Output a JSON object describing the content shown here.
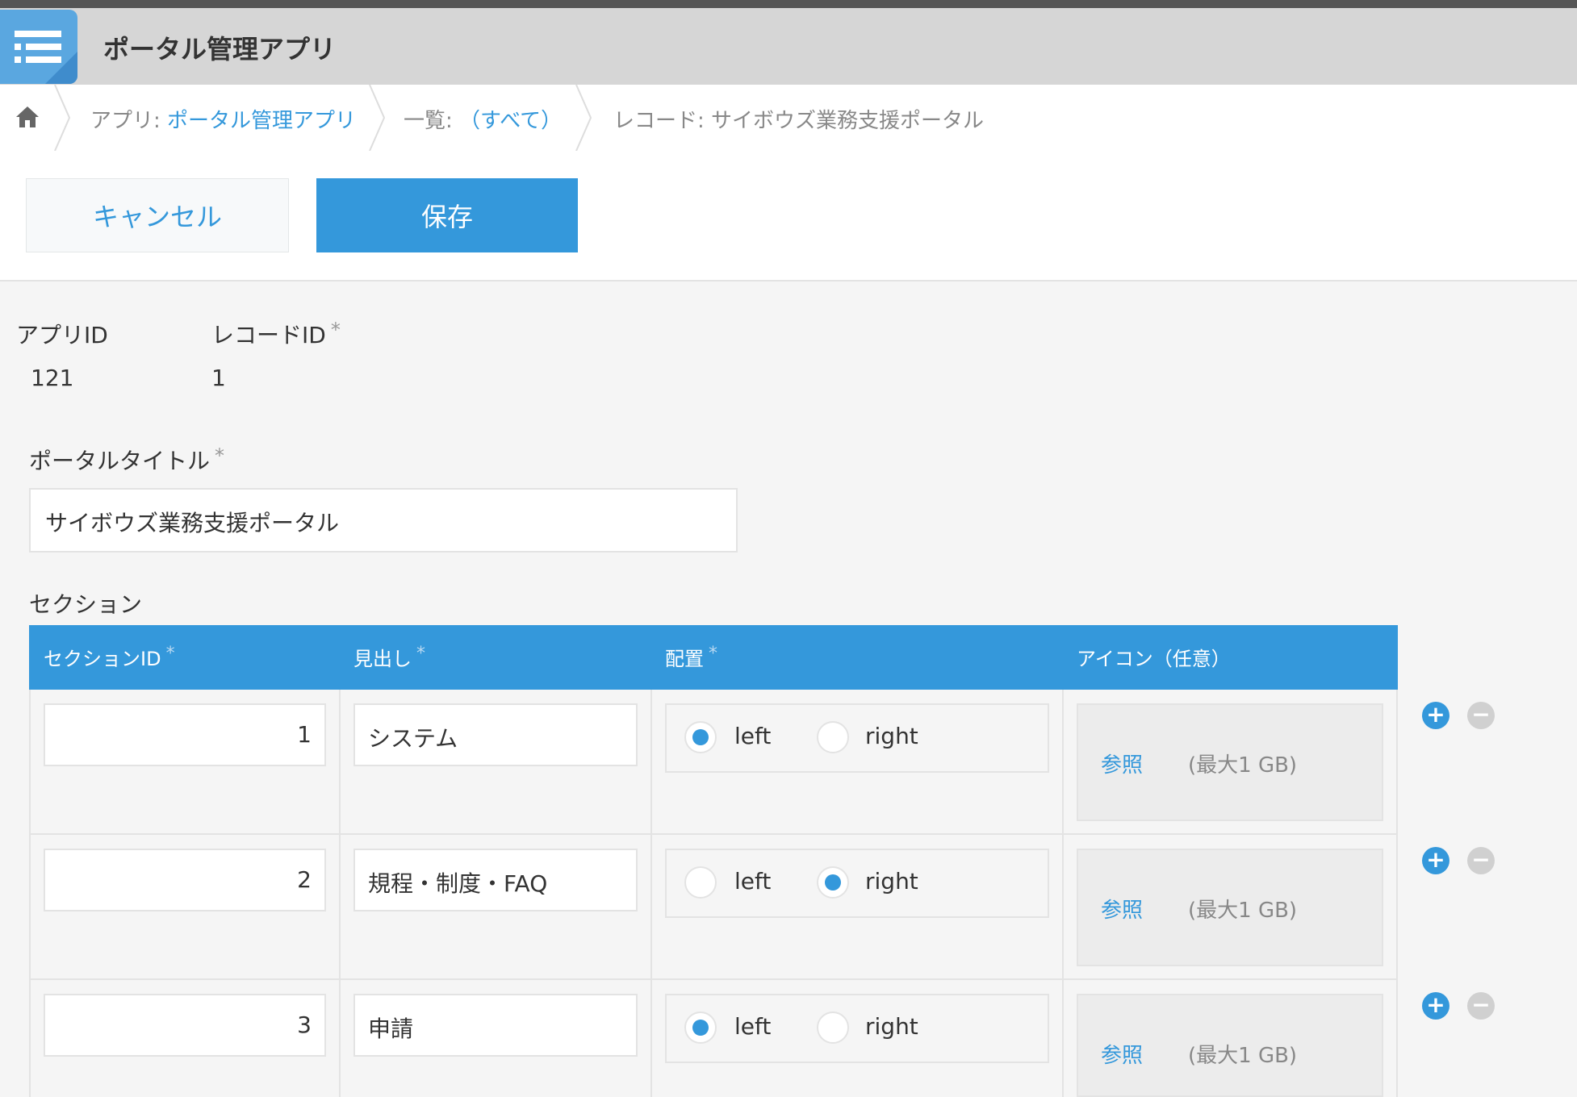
{
  "header": {
    "app_title": "ポータル管理アプリ"
  },
  "breadcrumb": {
    "app_prefix": "アプリ:",
    "app_link": "ポータル管理アプリ",
    "list_prefix": "一覧:",
    "list_link": "（すべて）",
    "record_label": "レコード: サイボウズ業務支援ポータル"
  },
  "toolbar": {
    "cancel_label": "キャンセル",
    "save_label": "保存"
  },
  "fields": {
    "app_id_label": "アプリID",
    "app_id_value": "121",
    "record_id_label": "レコードID",
    "record_id_value": "1",
    "required_mark": "*",
    "portal_title_label": "ポータルタイトル",
    "portal_title_value": "サイボウズ業務支援ポータル"
  },
  "section_table": {
    "label": "セクション",
    "headers": {
      "id": "セクションID",
      "heading": "見出し",
      "placement": "配置",
      "icon": "アイコン（任意）"
    },
    "rows": [
      {
        "id": "1",
        "heading": "システム",
        "left_label": "left",
        "right_label": "right",
        "selected": "left",
        "browse": "参照",
        "max": "(最大1 GB)"
      },
      {
        "id": "2",
        "heading": "規程・制度・FAQ",
        "left_label": "left",
        "right_label": "right",
        "selected": "right",
        "browse": "参照",
        "max": "(最大1 GB)"
      },
      {
        "id": "3",
        "heading": "申請",
        "left_label": "left",
        "right_label": "right",
        "selected": "left",
        "browse": "参照",
        "max": "(最大1 GB)"
      }
    ],
    "add_symbol": "+",
    "remove_symbol": "−"
  },
  "colors": {
    "accent": "#3498db",
    "header_bg": "#d6d6d6",
    "page_bg": "#f5f5f5"
  }
}
